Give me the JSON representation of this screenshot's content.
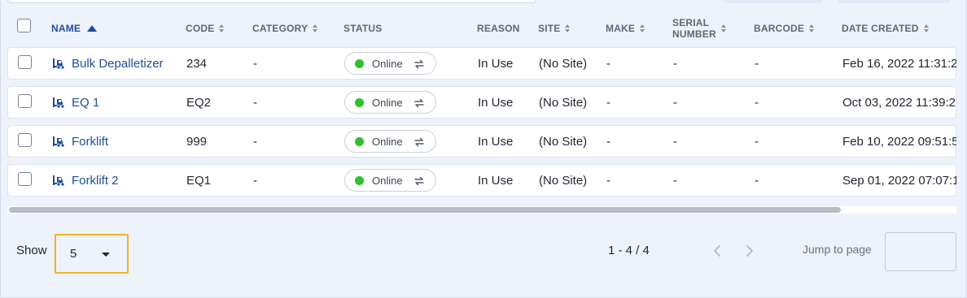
{
  "table": {
    "columns": [
      {
        "key": "name",
        "label": "NAME"
      },
      {
        "key": "code",
        "label": "CODE"
      },
      {
        "key": "category",
        "label": "CATEGORY"
      },
      {
        "key": "status",
        "label": "STATUS"
      },
      {
        "key": "reason",
        "label": "REASON"
      },
      {
        "key": "site",
        "label": "SITE"
      },
      {
        "key": "make",
        "label": "MAKE"
      },
      {
        "key": "serial",
        "label_line1": "SERIAL",
        "label_line2": "NUMBER"
      },
      {
        "key": "barcode",
        "label": "BARCODE"
      },
      {
        "key": "date_created",
        "label": "DATE CREATED"
      }
    ],
    "rows": [
      {
        "name": "Bulk Depalletizer",
        "code": "234",
        "category": "-",
        "status": "Online",
        "reason": "In Use",
        "site": "(No Site)",
        "make": "-",
        "serial": "-",
        "barcode": "-",
        "date_created": "Feb 16, 2022 11:31:2"
      },
      {
        "name": "EQ 1",
        "code": "EQ2",
        "category": "-",
        "status": "Online",
        "reason": "In Use",
        "site": "(No Site)",
        "make": "-",
        "serial": "-",
        "barcode": "-",
        "date_created": "Oct 03, 2022 11:39:2"
      },
      {
        "name": "Forklift",
        "code": "999",
        "category": "-",
        "status": "Online",
        "reason": "In Use",
        "site": "(No Site)",
        "make": "-",
        "serial": "-",
        "barcode": "-",
        "date_created": "Feb 10, 2022 09:51:5"
      },
      {
        "name": "Forklift 2",
        "code": "EQ1",
        "category": "-",
        "status": "Online",
        "reason": "In Use",
        "site": "(No Site)",
        "make": "-",
        "serial": "-",
        "barcode": "-",
        "date_created": "Sep 01, 2022 07:07:1"
      }
    ],
    "row_icon": "forklift-icon",
    "status_icon": "sync-icon"
  },
  "footer": {
    "show_label": "Show",
    "page_size": "5",
    "range": "1 - 4 / 4",
    "jump_label": "Jump to page",
    "jump_value": ""
  },
  "colors": {
    "accent": "#1f4c99",
    "online": "#2ec12e",
    "focus": "#f0b429",
    "background": "#eef2fb"
  }
}
